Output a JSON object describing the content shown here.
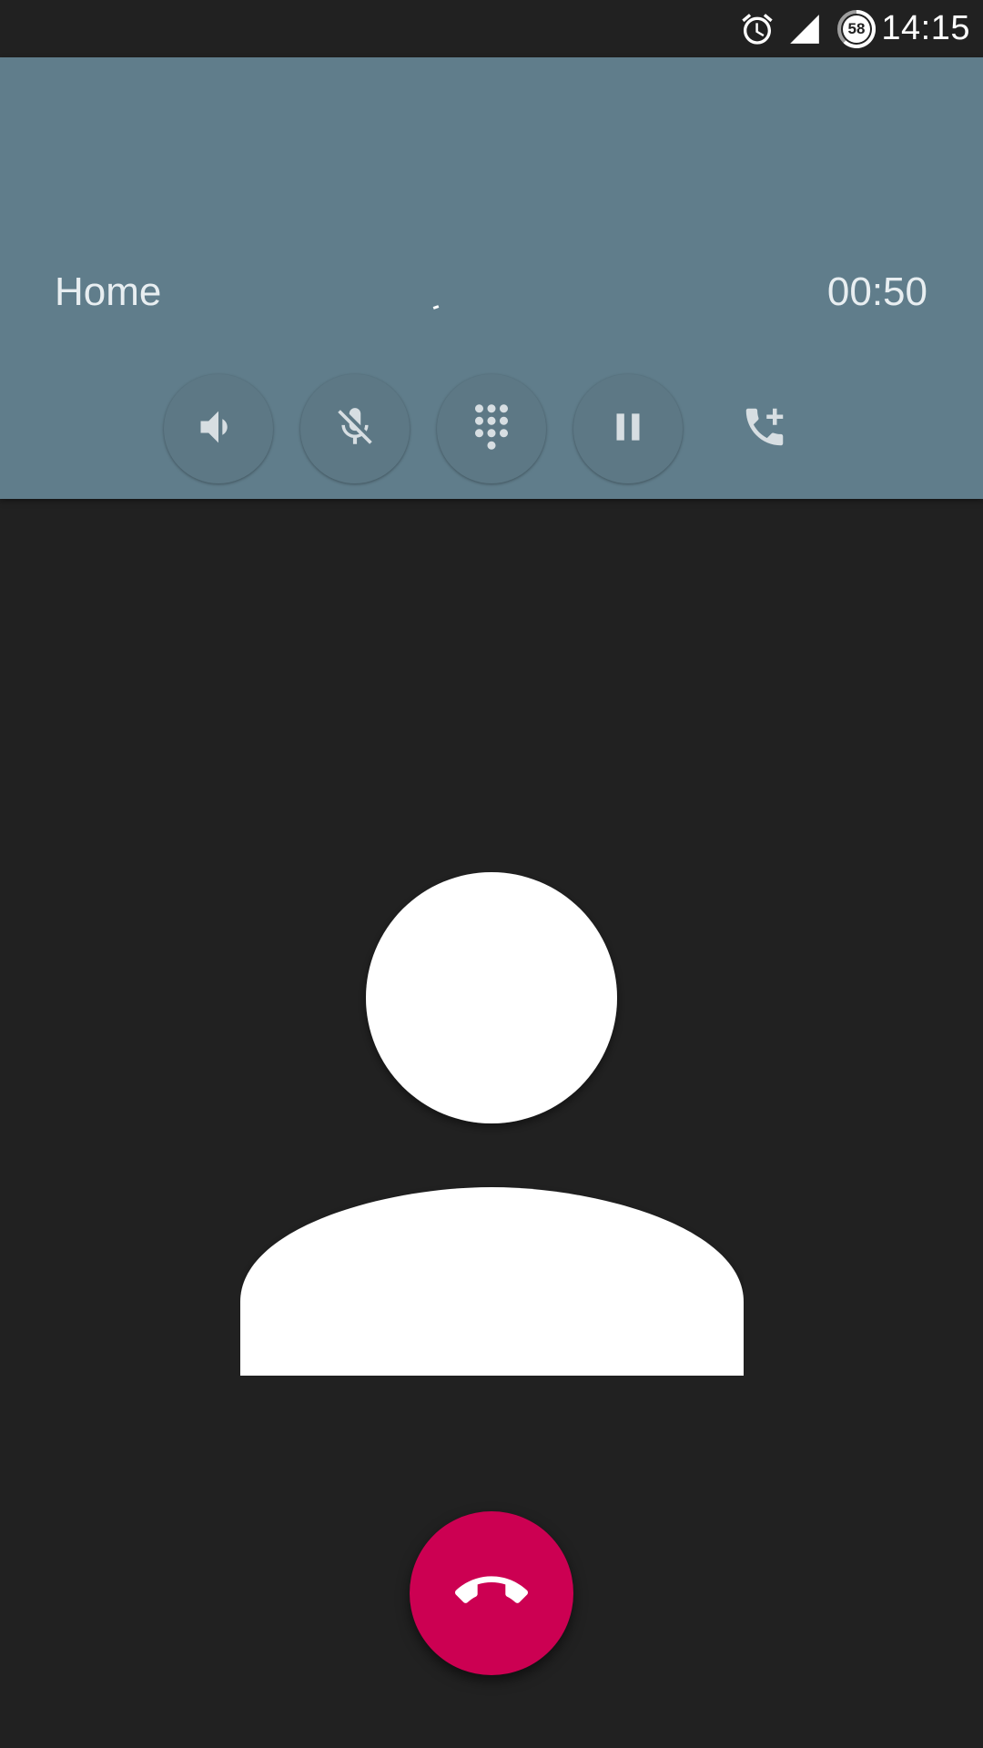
{
  "status_bar": {
    "time": "14:15",
    "battery_level": "58",
    "icons": [
      "alarm-icon",
      "cell-signal-icon",
      "battery-icon"
    ]
  },
  "call": {
    "label": "Home",
    "duration": "00:50"
  },
  "controls": [
    {
      "name": "speaker-button",
      "icon": "speaker-icon"
    },
    {
      "name": "mute-button",
      "icon": "mic-off-icon"
    },
    {
      "name": "dialpad-button",
      "icon": "dialpad-icon"
    },
    {
      "name": "hold-button",
      "icon": "pause-icon"
    },
    {
      "name": "add-call-button",
      "icon": "add-call-icon"
    }
  ],
  "colors": {
    "header_bg": "#607d8b",
    "background": "#212121",
    "end_call": "#cc0052",
    "control_icon": "#d7dee2"
  }
}
